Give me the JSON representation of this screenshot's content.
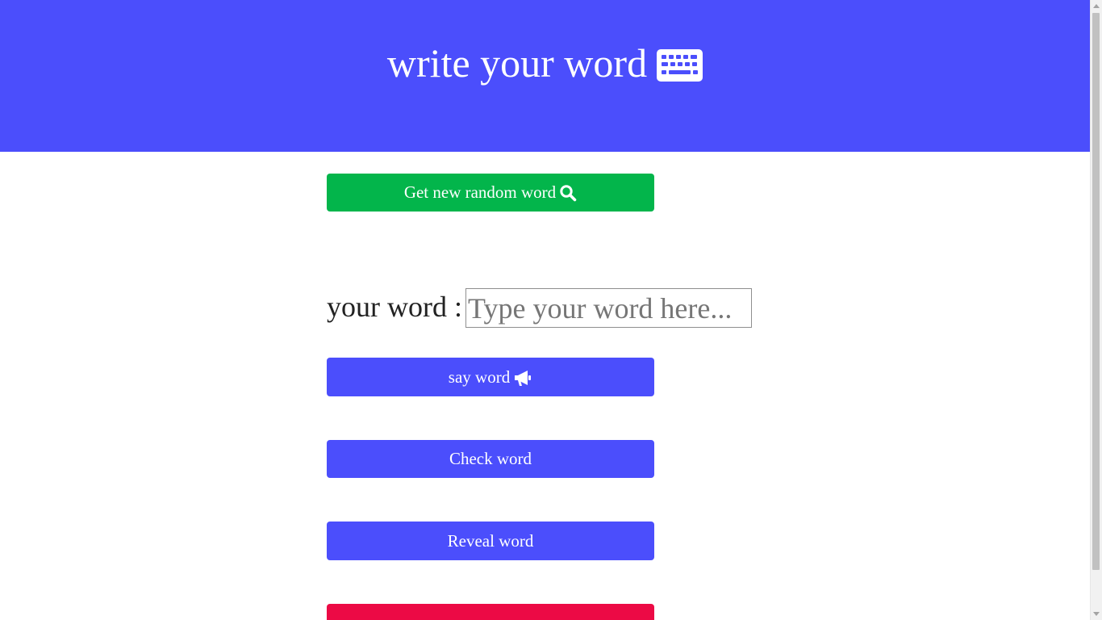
{
  "header": {
    "title": "write your word",
    "icon": "keyboard-icon",
    "background": "#4b4efc"
  },
  "buttons": {
    "random": {
      "label": "Get new random word",
      "icon": "search-icon",
      "color": "#03b54b"
    },
    "say": {
      "label": "say word",
      "icon": "megaphone-icon",
      "color": "#4b4efc"
    },
    "check": {
      "label": "Check word",
      "color": "#4b4efc"
    },
    "reveal": {
      "label": "Reveal word",
      "color": "#4b4efc"
    },
    "fourth": {
      "color": "#ec0a45"
    }
  },
  "word_input": {
    "label": "your word :",
    "placeholder": "Type your word here...",
    "value": ""
  }
}
